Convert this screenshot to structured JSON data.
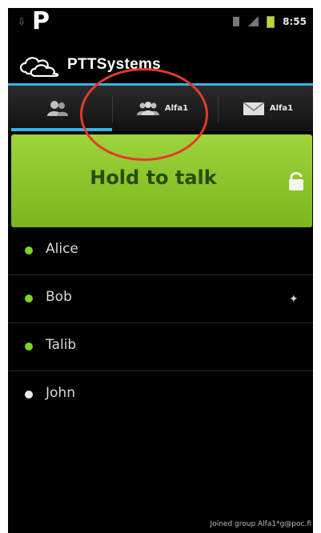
{
  "status_bar": {
    "time": "8:55",
    "usb_icon": "usb-icon",
    "app_notification_icon": "p-icon",
    "app_notification_glyph": "P"
  },
  "header": {
    "app_title": "PTTSystems",
    "logo_icon": "clouds-logo-icon"
  },
  "tabs": [
    {
      "icon": "contacts-icon",
      "label": ""
    },
    {
      "icon": "group-icon",
      "label": "Alfa1"
    },
    {
      "icon": "mail-icon",
      "label": "Alfa1"
    }
  ],
  "ptt_button": {
    "label": "Hold to talk",
    "lock_icon": "lock-icon"
  },
  "contacts": [
    {
      "name": "Alice",
      "status": "online",
      "extra": ""
    },
    {
      "name": "Bob",
      "status": "online",
      "extra": "✦"
    },
    {
      "name": "Talib",
      "status": "online",
      "extra": ""
    },
    {
      "name": "John",
      "status": "offline",
      "extra": ""
    }
  ],
  "footer_status": "Joined group Alfa1*g@poc.fi",
  "colors": {
    "accent": "#33b5e5",
    "ptt_green": "#8cc82a",
    "online": "#7ed321",
    "annotation_ring": "#e33a2a"
  }
}
